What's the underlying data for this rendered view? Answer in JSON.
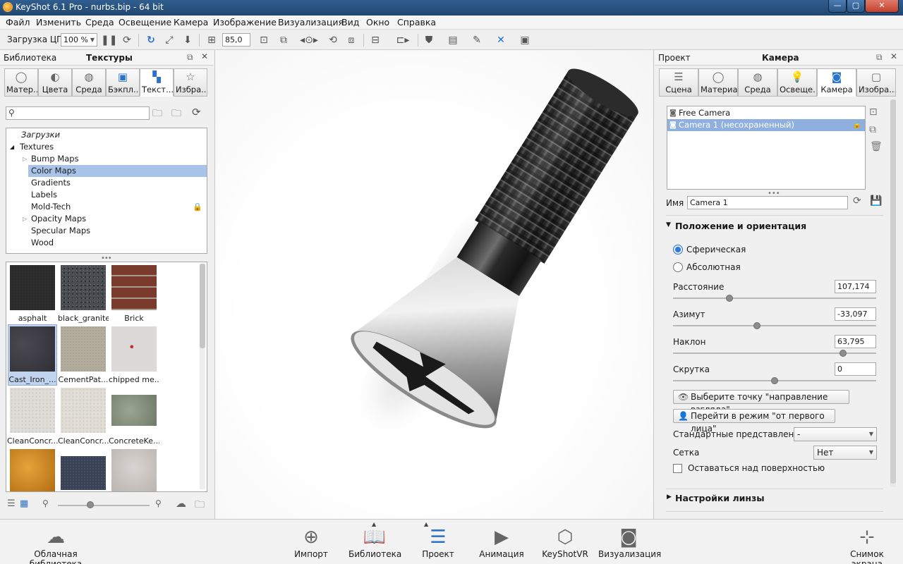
{
  "window": {
    "title": "KeyShot 6.1 Pro  - nurbs.bip  - 64 bit",
    "min": "—",
    "max": "▢",
    "close": "✕"
  },
  "menu": [
    "Файл",
    "Изменить",
    "Среда",
    "Освещение",
    "Камера",
    "Изображение",
    "Визуализация",
    "Вид",
    "Окно",
    "Справка"
  ],
  "toolbar": {
    "cpu_label": "Загрузка ЦП",
    "zoom_value": "100 %",
    "fov_value": "85,0"
  },
  "left_panel": {
    "header_left": "Библиотека",
    "header_title": "Текстуры",
    "tabs": [
      "Матер...",
      "Цвета",
      "Среда",
      "Бэкпл...",
      "Текст...",
      "Избра..."
    ],
    "search_placeholder": "",
    "tree": {
      "downloads": "Загрузки",
      "root": "Textures",
      "items": [
        "Bump Maps",
        "Color Maps",
        "Gradients",
        "Labels",
        "Mold-Tech",
        "Opacity Maps",
        "Specular Maps",
        "Wood"
      ]
    },
    "thumbs": [
      "asphalt",
      "black_granite",
      "Brick",
      "Cast_Iron_...",
      "CementPat...",
      "chipped me...",
      "CleanConcr...",
      "CleanConcr...",
      "ConcreteKe...",
      "",
      "",
      ""
    ]
  },
  "right_panel": {
    "header_left": "Проект",
    "header_title": "Камера",
    "tabs": [
      "Сцена",
      "Материал",
      "Среда",
      "Освеще...",
      "Камера",
      "Изобра..."
    ],
    "cameras": [
      "Free Camera",
      "Camera 1 (несохраненный)"
    ],
    "name_label": "Имя",
    "name_value": "Camera 1",
    "section_position": "Положение и ориентация",
    "radio_spherical": "Сферическая",
    "radio_absolute": "Абсолютная",
    "distance_label": "Расстояние",
    "distance_value": "107,174",
    "azimuth_label": "Азимут",
    "azimuth_value": "-33,097",
    "incline_label": "Наклон",
    "incline_value": "63,795",
    "twist_label": "Скрутка",
    "twist_value": "0",
    "btn_look": "Выберите точку \"направление взгляда\"",
    "btn_first_person": "Перейти в режим \"от первого лица\"",
    "std_views_label": "Стандартные представления",
    "std_views_value": "-",
    "grid_label": "Сетка",
    "grid_value": "Нет",
    "stay_above_label": "Оставаться над поверхностью",
    "section_lens": "Настройки линзы"
  },
  "bottom": {
    "cloud": "Облачная библиотека",
    "import": "Импорт",
    "library": "Библиотека",
    "project": "Проект",
    "animation": "Анимация",
    "keyshotvr": "KeyShotVR",
    "render": "Визуализация",
    "screenshot": "Снимок экрана"
  }
}
